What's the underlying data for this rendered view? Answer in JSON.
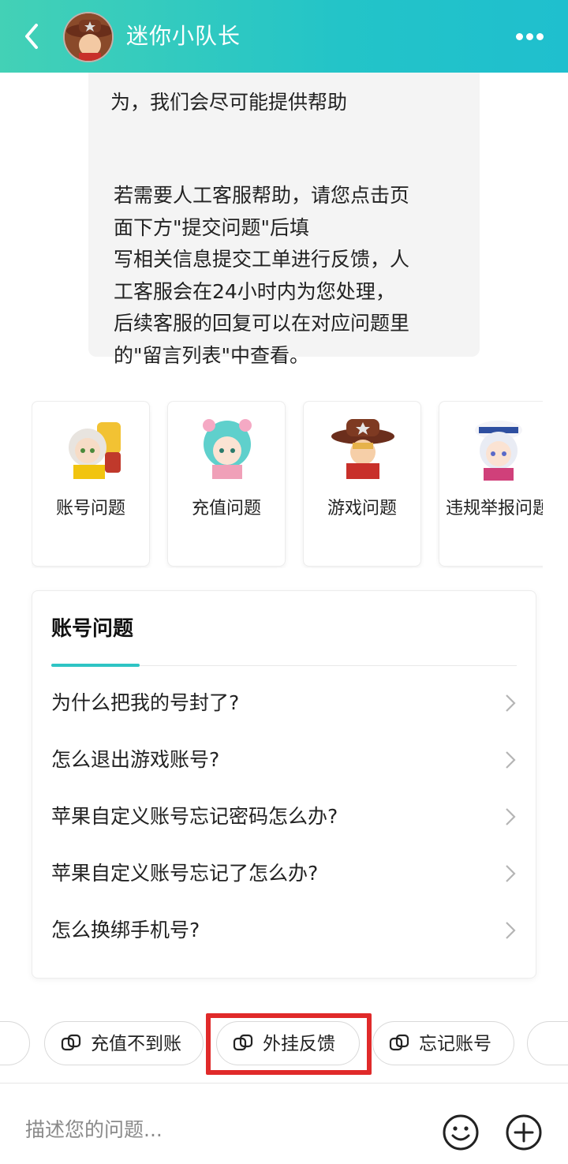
{
  "header": {
    "title": "迷你小队长",
    "back_icon": "chevron-left-icon",
    "more_icon": "more-dots-icon",
    "background": "#2cc9c2"
  },
  "message": {
    "clipped_text": "为，我们会尽可能提供帮助",
    "text": "若需要人工客服帮助，请您点击页\n面下方\"提交问题\"后填\n写相关信息提交工单进行反馈，人\n工客服会在24小时内为您处理，\n后续客服的回复可以在对应问题里\n的\"留言列表\"中查看。"
  },
  "categories": [
    {
      "label": "账号问题",
      "icon": "character-avatar-1"
    },
    {
      "label": "充值问题",
      "icon": "character-avatar-2"
    },
    {
      "label": "游戏问题",
      "icon": "character-avatar-3"
    },
    {
      "label": "违规举报问题",
      "icon": "character-avatar-4"
    }
  ],
  "faq": {
    "title": "账号问题",
    "accent": "#2ec4c4",
    "items": [
      "为什么把我的号封了?",
      "怎么退出游戏账号?",
      "苹果自定义账号忘记密码怎么办?",
      "苹果自定义账号忘记了怎么办?",
      "怎么换绑手机号?"
    ]
  },
  "chips": [
    {
      "label": "充值不到账"
    },
    {
      "label": "外挂反馈"
    },
    {
      "label": "忘记账号"
    }
  ],
  "highlight_color": "#e02a2a",
  "input": {
    "placeholder": "描述您的问题...",
    "emoji_icon": "smiley-icon",
    "plus_icon": "plus-circle-icon"
  }
}
